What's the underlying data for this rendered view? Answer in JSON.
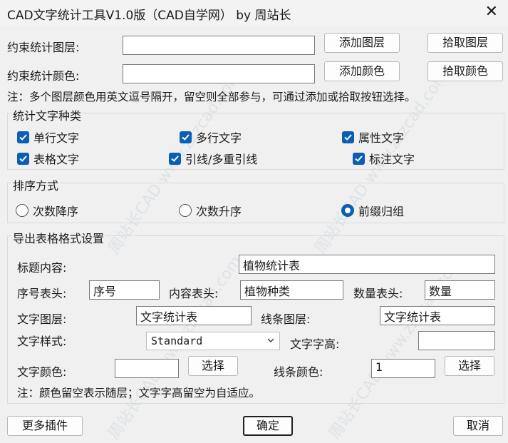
{
  "window": {
    "title": "CAD文字统计工具V1.0版（CAD自学网） by 周站长",
    "close_glyph": "✕"
  },
  "layer": {
    "label": "约束统计图层:",
    "value": "",
    "add_button": "添加图层",
    "pick_button": "拾取图层"
  },
  "color": {
    "label": "约束统计颜色:",
    "value": "",
    "add_button": "添加颜色",
    "pick_button": "拾取颜色"
  },
  "note1": "注：多个图层颜色用英文逗号隔开，留空则全部参与，可通过添加或拾取按钮选择。",
  "text_types": {
    "title": "统计文字种类",
    "items": [
      {
        "label": "单行文字",
        "checked": true
      },
      {
        "label": "多行文字",
        "checked": true
      },
      {
        "label": "属性文字",
        "checked": true
      },
      {
        "label": "表格文字",
        "checked": true
      },
      {
        "label": "引线/多重引线",
        "checked": true
      },
      {
        "label": "标注文字",
        "checked": true
      }
    ]
  },
  "sort": {
    "title": "排序方式",
    "options": [
      {
        "label": "次数降序",
        "selected": false
      },
      {
        "label": "次数升序",
        "selected": false
      },
      {
        "label": "前缀归组",
        "selected": true
      }
    ]
  },
  "export": {
    "title": "导出表格格式设置",
    "title_content": {
      "label": "标题内容:",
      "value": "植物统计表"
    },
    "seq_header": {
      "label": "序号表头:",
      "value": "序号"
    },
    "content_header": {
      "label": "内容表头:",
      "value": "植物种类"
    },
    "qty_header": {
      "label": "数量表头:",
      "value": "数量"
    },
    "text_layer": {
      "label": "文字图层:",
      "value": "文字统计表"
    },
    "line_layer": {
      "label": "线条图层:",
      "value": "文字统计表"
    },
    "text_style": {
      "label": "文字样式:",
      "value": "Standard"
    },
    "text_height": {
      "label": "文字字高:",
      "value": ""
    },
    "text_color": {
      "label": "文字颜色:",
      "value": "",
      "button": "选择"
    },
    "line_color": {
      "label": "线条颜色:",
      "value": "1",
      "button": "选择"
    },
    "note2": "注：颜色留空表示随层；文字字高留空为自适应。"
  },
  "footer": {
    "more_button": "更多插件",
    "ok_button": "确定",
    "cancel_button": "取消"
  },
  "watermark": {
    "text": "周站长CAD www.zzzcad.com"
  },
  "colors": {
    "accent": "#0a5fb4",
    "background": "#f0f0f0"
  }
}
